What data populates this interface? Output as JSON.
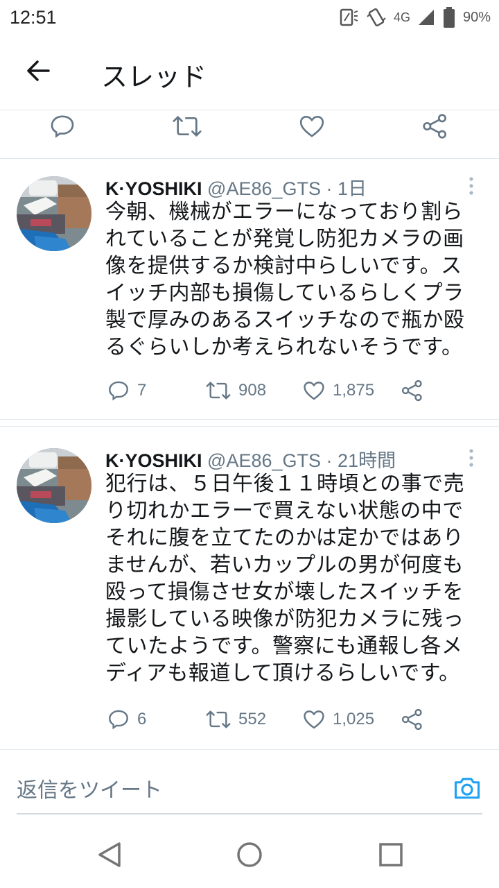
{
  "status_bar": {
    "time": "12:51",
    "network": "4G",
    "battery": "90%"
  },
  "header": {
    "title": "スレッド"
  },
  "top_actions": {
    "icons": [
      "reply-icon",
      "retweet-icon",
      "like-icon",
      "share-icon"
    ]
  },
  "tweets": [
    {
      "name": "K·YOSHIKI",
      "handle": "@AE86_GTS",
      "separator": "·",
      "time": "1日",
      "text": "今朝、機械がエラーになっており割られていることが発覚し防犯カメラの画像を提供するか検討中らしいです。スイッチ内部も損傷しているらしくプラ製で厚みのあるスイッチなので瓶か殴るぐらいしか考えられないそうです。",
      "replies": "7",
      "retweets": "908",
      "likes": "1,875"
    },
    {
      "name": "K·YOSHIKI",
      "handle": "@AE86_GTS",
      "separator": "·",
      "time": "21時間",
      "text": "犯行は、５日午後１１時頃との事で売り切れかエラーで買えない状態の中でそれに腹を立てたのかは定かではありませんが、若いカップルの男が何度も殴って損傷させ女が壊したスイッチを撮影している映像が防犯カメラに残っていたようです。警察にも通報し各メディアも報道して頂けるらしいです。",
      "replies": "6",
      "retweets": "552",
      "likes": "1,025"
    }
  ],
  "reply_bar": {
    "placeholder": "返信をツイート"
  },
  "colors": {
    "accent": "#1da1f2",
    "icon_gray": "#657786",
    "divider": "#e1e8ed"
  }
}
